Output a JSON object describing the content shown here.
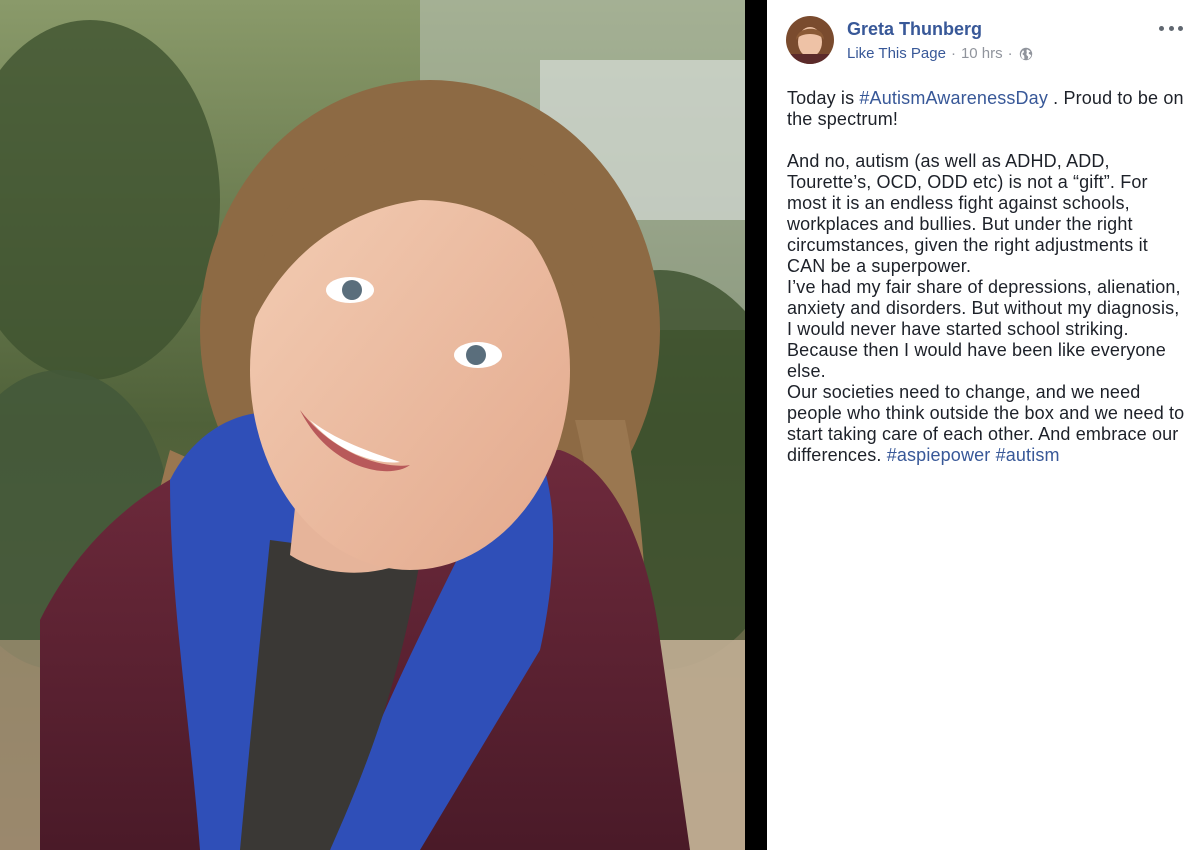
{
  "post": {
    "author": "Greta Thunberg",
    "like_page": "Like This Page",
    "separator": "·",
    "time": "10 hrs",
    "privacy_icon": "globe-icon",
    "more_icon": "more-options-icon",
    "photo_alt": "Photo of Greta Thunberg smiling, wearing a burgundy jacket over a blue hoodie, with braided hair, outdoors in front of ivy",
    "text": {
      "p1_before": "Today is ",
      "p1_tag": "#AutismAwarenessDay",
      "p1_after": " . Proud to be on the spectrum!",
      "p2": "And no, autism (as well as ADHD, ADD, Tourette’s, OCD, ODD etc) is not a “gift”. For most it is an endless fight against schools, workplaces and bullies. But under the right circumstances, given the right adjustments it CAN be a superpower.",
      "p3": "I’ve had my fair share of depressions, alienation, anxiety and disorders. But without my diagnosis, I would never have started school striking. Because then I would have been like everyone else.",
      "p4_before": "Our societies need to change, and we need people who think outside the box and we need to start taking care of each other. And embrace our differences. ",
      "p4_tag1": "#aspiepower",
      "p4_space": " ",
      "p4_tag2": "#autism"
    }
  },
  "colors": {
    "link": "#385898",
    "text": "#1d2129",
    "meta": "#90949c"
  }
}
